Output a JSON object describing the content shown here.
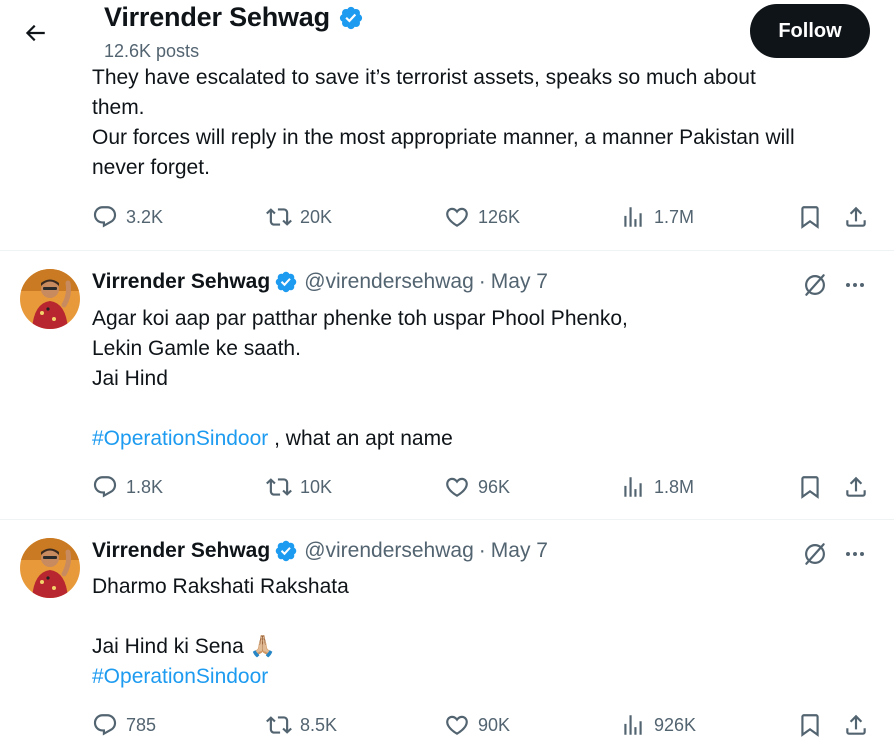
{
  "header": {
    "name": "Virrender Sehwag",
    "posts": "12.6K posts",
    "follow_label": "Follow"
  },
  "colors": {
    "accent": "#1d9bf0",
    "text": "#0f1419",
    "muted": "#536471",
    "divider": "#eff3f4"
  },
  "tweets": [
    {
      "lines": [
        "They have escalated to save it’s terrorist assets, speaks so much about",
        "them.",
        "Our forces will reply in the most appropriate manner, a manner Pakistan will",
        "never forget."
      ],
      "replies": "3.2K",
      "reposts": "20K",
      "likes": "126K",
      "views": "1.7M"
    },
    {
      "author": "Virrender Sehwag",
      "handle": "@virendersehwag",
      "date": "May 7",
      "lines": [
        "Agar koi aap par patthar phenke toh uspar Phool Phenko,",
        "Lekin Gamle ke saath.",
        "Jai Hind",
        ""
      ],
      "hashtag": "#OperationSindoor",
      "hashtag_suffix": " , what an apt name",
      "replies": "1.8K",
      "reposts": "10K",
      "likes": "96K",
      "views": "1.8M"
    },
    {
      "author": "Virrender Sehwag",
      "handle": "@virendersehwag",
      "date": "May 7",
      "lines": [
        "Dharmo Rakshati Rakshata",
        "",
        "Jai Hind ki Sena 🙏🏼"
      ],
      "hashtag": "#OperationSindoor",
      "replies": "785",
      "reposts": "8.5K",
      "likes": "90K",
      "views": "926K"
    }
  ]
}
